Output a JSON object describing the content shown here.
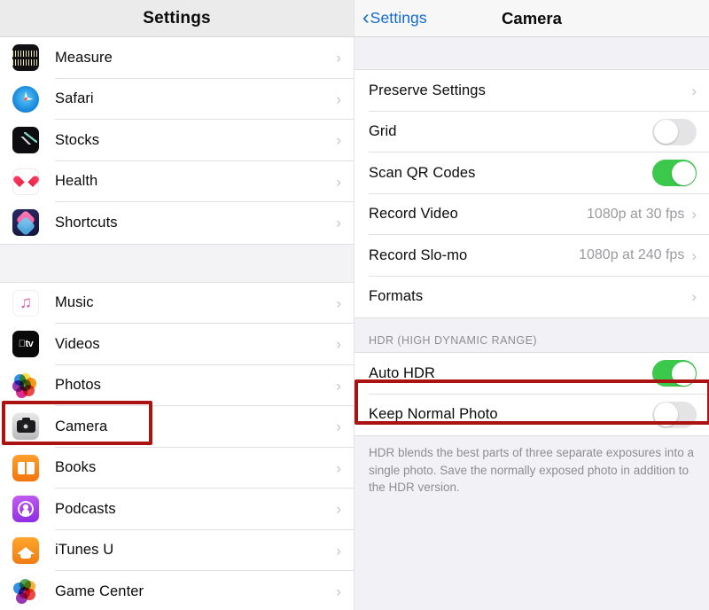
{
  "left": {
    "header_title": "Settings",
    "groups": [
      {
        "items": [
          {
            "label": "Measure",
            "icon": "measure-app-icon",
            "chevron": "›"
          },
          {
            "label": "Safari",
            "icon": "safari-app-icon",
            "chevron": "›"
          },
          {
            "label": "Stocks",
            "icon": "stocks-app-icon",
            "chevron": "›"
          },
          {
            "label": "Health",
            "icon": "health-app-icon",
            "chevron": "›"
          },
          {
            "label": "Shortcuts",
            "icon": "shortcuts-app-icon",
            "chevron": "›"
          }
        ]
      },
      {
        "items": [
          {
            "label": "Music",
            "icon": "music-app-icon",
            "chevron": "›"
          },
          {
            "label": "Videos",
            "icon": "videos-app-icon",
            "chevron": "›"
          },
          {
            "label": "Photos",
            "icon": "photos-app-icon",
            "chevron": "›"
          },
          {
            "label": "Camera",
            "icon": "camera-app-icon",
            "chevron": "›"
          },
          {
            "label": "Books",
            "icon": "books-app-icon",
            "chevron": "›"
          },
          {
            "label": "Podcasts",
            "icon": "podcasts-app-icon",
            "chevron": "›"
          },
          {
            "label": "iTunes U",
            "icon": "itunesu-app-icon",
            "chevron": "›"
          },
          {
            "label": "Game Center",
            "icon": "gamecenter-app-icon",
            "chevron": "›"
          }
        ]
      }
    ]
  },
  "right": {
    "back_label": "Settings",
    "back_chevron": "‹",
    "title": "Camera",
    "group1": [
      {
        "label": "Preserve Settings",
        "type": "disclosure",
        "value": "",
        "chevron": "›"
      },
      {
        "label": "Grid",
        "type": "toggle",
        "toggle_on": false
      },
      {
        "label": "Scan QR Codes",
        "type": "toggle",
        "toggle_on": true
      },
      {
        "label": "Record Video",
        "type": "disclosure",
        "value": "1080p at 30 fps",
        "chevron": "›"
      },
      {
        "label": "Record Slo-mo",
        "type": "disclosure",
        "value": "1080p at 240 fps",
        "chevron": "›"
      },
      {
        "label": "Formats",
        "type": "disclosure",
        "value": "",
        "chevron": "›"
      }
    ],
    "hdr_section_header": "HDR (HIGH DYNAMIC RANGE)",
    "group2": [
      {
        "label": "Auto HDR",
        "type": "toggle",
        "toggle_on": true
      },
      {
        "label": "Keep Normal Photo",
        "type": "toggle",
        "toggle_on": false
      }
    ],
    "hdr_footer": "HDR blends the best parts of three separate exposures into a single photo. Save the normally exposed photo in addition to the HDR version."
  },
  "annotations": {
    "highlight_color": "#ab1212",
    "boxes": [
      {
        "name": "camera-row-highlight",
        "target": "Camera"
      },
      {
        "name": "auto-hdr-row-highlight",
        "target": "Auto HDR"
      }
    ]
  },
  "colors": {
    "toggle_on": "#3cc84a",
    "toggle_off": "#e4e4e6",
    "accent_blue": "#1269cf",
    "group_bg": "#f2f2f6",
    "value_gray": "#9a9a9f"
  }
}
